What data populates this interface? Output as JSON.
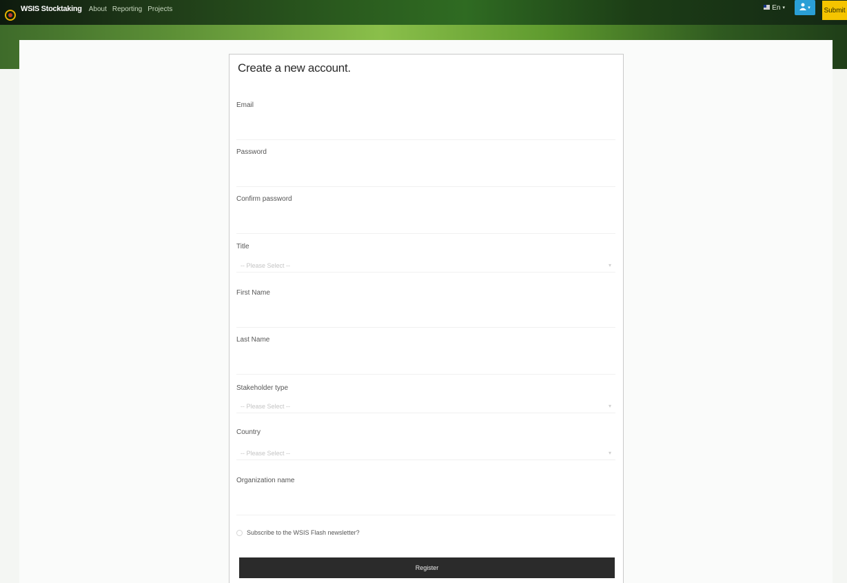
{
  "nav": {
    "brand": "WSIS Stocktaking",
    "links": [
      "About",
      "Reporting",
      "Projects"
    ],
    "language": "En",
    "submit_label": "Submit"
  },
  "form": {
    "title": "Create a new account.",
    "fields": {
      "email": {
        "label": "Email"
      },
      "password": {
        "label": "Password"
      },
      "confirm_password": {
        "label": "Confirm password"
      },
      "title": {
        "label": "Title",
        "selected": "-- Please Select --"
      },
      "first_name": {
        "label": "First Name"
      },
      "last_name": {
        "label": "Last Name"
      },
      "stakeholder_type": {
        "label": "Stakeholder type",
        "selected": "-- Please Select --"
      },
      "country": {
        "label": "Country",
        "selected": "-- Please Select --"
      },
      "organization_name": {
        "label": "Organization name"
      }
    },
    "newsletter_label": "Subscribe to the WSIS Flash newsletter?",
    "register_label": "Register"
  },
  "colors": {
    "navbar": "#1f3a18",
    "banner_accent": "#8abf4a",
    "user_button": "#2a9fd6",
    "submit_button": "#f5c400",
    "register_button": "#2b2b2b"
  },
  "icons": {
    "logo": "wsis-logo-icon",
    "flag": "flag-icon",
    "user": "user-icon",
    "caret": "chevron-down-icon"
  }
}
